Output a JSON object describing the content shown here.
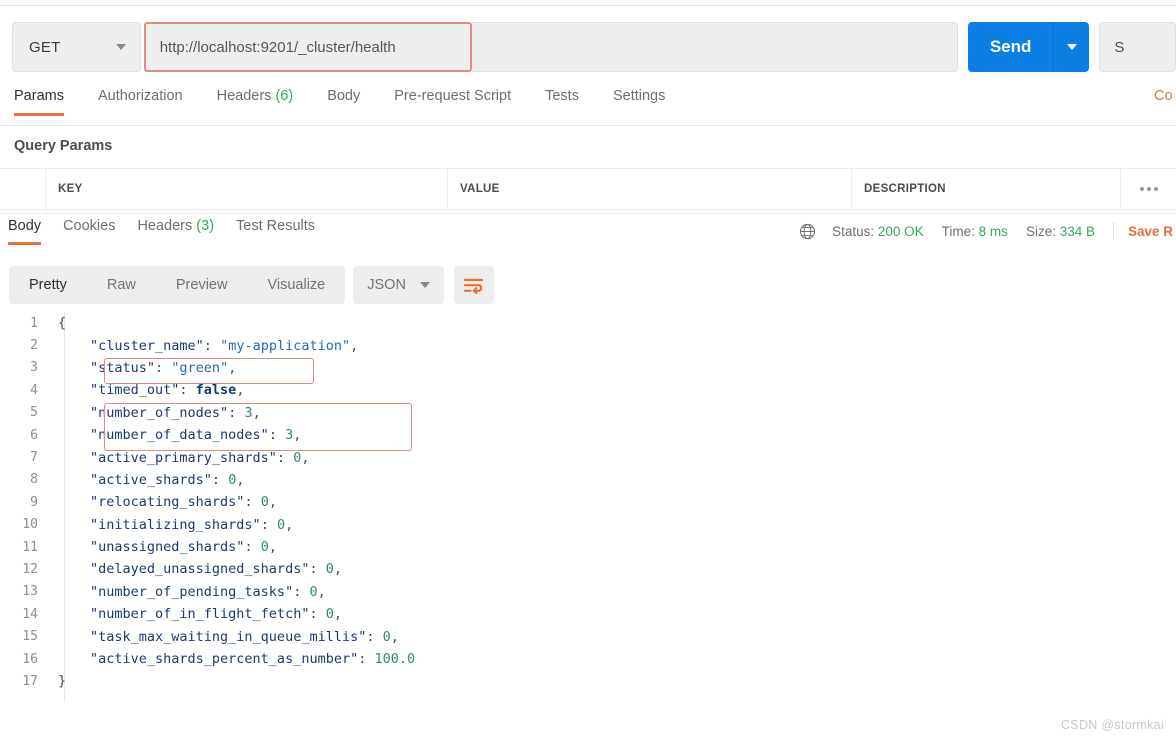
{
  "request": {
    "method": "GET",
    "url": "http://localhost:9201/_cluster/health",
    "send_label": "Send",
    "save_label": "S",
    "tabs": [
      {
        "label": "Params",
        "count": "",
        "active": true
      },
      {
        "label": "Authorization",
        "count": "",
        "active": false
      },
      {
        "label": "Headers",
        "count": "(6)",
        "active": false
      },
      {
        "label": "Body",
        "count": "",
        "active": false
      },
      {
        "label": "Pre-request Script",
        "count": "",
        "active": false
      },
      {
        "label": "Tests",
        "count": "",
        "active": false
      },
      {
        "label": "Settings",
        "count": "",
        "active": false
      }
    ],
    "cookies_link": "Co"
  },
  "query_params": {
    "title": "Query Params",
    "columns": [
      "KEY",
      "VALUE",
      "DESCRIPTION"
    ],
    "rows": []
  },
  "response": {
    "tabs": [
      {
        "label": "Body",
        "count": "",
        "active": true
      },
      {
        "label": "Cookies",
        "count": "",
        "active": false
      },
      {
        "label": "Headers",
        "count": "(3)",
        "active": false
      },
      {
        "label": "Test Results",
        "count": "",
        "active": false
      }
    ],
    "status_label": "Status:",
    "status_value": "200 OK",
    "time_label": "Time:",
    "time_value": "8 ms",
    "size_label": "Size:",
    "size_value": "334 B",
    "save_response": "Save R",
    "view_modes": [
      {
        "label": "Pretty",
        "active": true
      },
      {
        "label": "Raw",
        "active": false
      },
      {
        "label": "Preview",
        "active": false
      },
      {
        "label": "Visualize",
        "active": false
      }
    ],
    "format": "JSON"
  },
  "body": {
    "lines": [
      {
        "num": "1",
        "indent": 0,
        "tokens": [
          {
            "t": "{",
            "c": "br"
          }
        ]
      },
      {
        "num": "2",
        "indent": 1,
        "tokens": [
          {
            "t": "\"cluster_name\"",
            "c": "k"
          },
          {
            "t": ": ",
            "c": "p"
          },
          {
            "t": "\"my-application\"",
            "c": "s"
          },
          {
            "t": ",",
            "c": "p"
          }
        ]
      },
      {
        "num": "3",
        "indent": 1,
        "tokens": [
          {
            "t": "\"status\"",
            "c": "k"
          },
          {
            "t": ": ",
            "c": "p"
          },
          {
            "t": "\"green\"",
            "c": "s"
          },
          {
            "t": ",",
            "c": "p"
          }
        ]
      },
      {
        "num": "4",
        "indent": 1,
        "tokens": [
          {
            "t": "\"timed_out\"",
            "c": "k"
          },
          {
            "t": ": ",
            "c": "p"
          },
          {
            "t": "false",
            "c": "b"
          },
          {
            "t": ",",
            "c": "p"
          }
        ]
      },
      {
        "num": "5",
        "indent": 1,
        "tokens": [
          {
            "t": "\"number_of_nodes\"",
            "c": "k"
          },
          {
            "t": ": ",
            "c": "p"
          },
          {
            "t": "3",
            "c": "n"
          },
          {
            "t": ",",
            "c": "p"
          }
        ]
      },
      {
        "num": "6",
        "indent": 1,
        "tokens": [
          {
            "t": "\"number_of_data_nodes\"",
            "c": "k"
          },
          {
            "t": ": ",
            "c": "p"
          },
          {
            "t": "3",
            "c": "n"
          },
          {
            "t": ",",
            "c": "p"
          }
        ]
      },
      {
        "num": "7",
        "indent": 1,
        "tokens": [
          {
            "t": "\"active_primary_shards\"",
            "c": "k"
          },
          {
            "t": ": ",
            "c": "p"
          },
          {
            "t": "0",
            "c": "n"
          },
          {
            "t": ",",
            "c": "p"
          }
        ]
      },
      {
        "num": "8",
        "indent": 1,
        "tokens": [
          {
            "t": "\"active_shards\"",
            "c": "k"
          },
          {
            "t": ": ",
            "c": "p"
          },
          {
            "t": "0",
            "c": "n"
          },
          {
            "t": ",",
            "c": "p"
          }
        ]
      },
      {
        "num": "9",
        "indent": 1,
        "tokens": [
          {
            "t": "\"relocating_shards\"",
            "c": "k"
          },
          {
            "t": ": ",
            "c": "p"
          },
          {
            "t": "0",
            "c": "n"
          },
          {
            "t": ",",
            "c": "p"
          }
        ]
      },
      {
        "num": "10",
        "indent": 1,
        "tokens": [
          {
            "t": "\"initializing_shards\"",
            "c": "k"
          },
          {
            "t": ": ",
            "c": "p"
          },
          {
            "t": "0",
            "c": "n"
          },
          {
            "t": ",",
            "c": "p"
          }
        ]
      },
      {
        "num": "11",
        "indent": 1,
        "tokens": [
          {
            "t": "\"unassigned_shards\"",
            "c": "k"
          },
          {
            "t": ": ",
            "c": "p"
          },
          {
            "t": "0",
            "c": "n"
          },
          {
            "t": ",",
            "c": "p"
          }
        ]
      },
      {
        "num": "12",
        "indent": 1,
        "tokens": [
          {
            "t": "\"delayed_unassigned_shards\"",
            "c": "k"
          },
          {
            "t": ": ",
            "c": "p"
          },
          {
            "t": "0",
            "c": "n"
          },
          {
            "t": ",",
            "c": "p"
          }
        ]
      },
      {
        "num": "13",
        "indent": 1,
        "tokens": [
          {
            "t": "\"number_of_pending_tasks\"",
            "c": "k"
          },
          {
            "t": ": ",
            "c": "p"
          },
          {
            "t": "0",
            "c": "n"
          },
          {
            "t": ",",
            "c": "p"
          }
        ]
      },
      {
        "num": "14",
        "indent": 1,
        "tokens": [
          {
            "t": "\"number_of_in_flight_fetch\"",
            "c": "k"
          },
          {
            "t": ": ",
            "c": "p"
          },
          {
            "t": "0",
            "c": "n"
          },
          {
            "t": ",",
            "c": "p"
          }
        ]
      },
      {
        "num": "15",
        "indent": 1,
        "tokens": [
          {
            "t": "\"task_max_waiting_in_queue_millis\"",
            "c": "k"
          },
          {
            "t": ": ",
            "c": "p"
          },
          {
            "t": "0",
            "c": "n"
          },
          {
            "t": ",",
            "c": "p"
          }
        ]
      },
      {
        "num": "16",
        "indent": 1,
        "tokens": [
          {
            "t": "\"active_shards_percent_as_number\"",
            "c": "k"
          },
          {
            "t": ": ",
            "c": "p"
          },
          {
            "t": "100.0",
            "c": "n"
          }
        ]
      },
      {
        "num": "17",
        "indent": 0,
        "tokens": [
          {
            "t": "}",
            "c": "br"
          }
        ]
      }
    ]
  },
  "watermark": "CSDN @stormkai",
  "colors": {
    "accent_orange": "#e8703a",
    "send_blue": "#0c7fe4",
    "success_green": "#3ba55d",
    "highlight_red": "#e08a80"
  }
}
